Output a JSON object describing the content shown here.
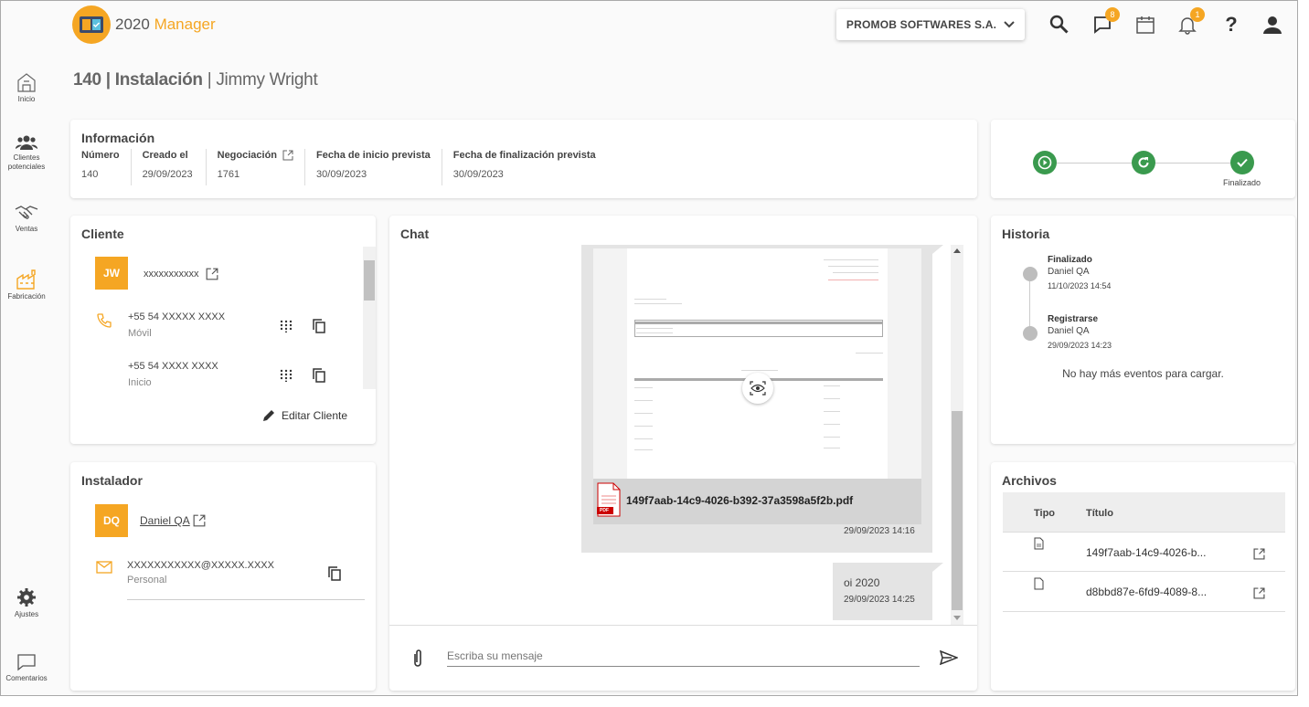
{
  "app": {
    "name_a": "2020",
    "name_b": "Manager",
    "company": "PROMOB SOFTWARES S.A.",
    "messages_count": "8",
    "notifications_count": "1",
    "help_label": "?"
  },
  "nav": [
    {
      "label": "Inicio"
    },
    {
      "label": "Clientes potenciales"
    },
    {
      "label": "Ventas"
    },
    {
      "label": "Fabricación"
    },
    {
      "label": "Ajustes"
    },
    {
      "label": "Comentarios"
    }
  ],
  "title": {
    "bold": "140 | Instalación",
    "normal": " | Jimmy Wright"
  },
  "info": {
    "title": "Información",
    "columns": [
      {
        "label": "Número",
        "value": "140"
      },
      {
        "label": "Creado el",
        "value": "29/09/2023"
      },
      {
        "label": "Negociación",
        "value": "1761"
      },
      {
        "label": "Fecha de inicio prevista",
        "value": "30/09/2023"
      },
      {
        "label": "Fecha de finalización prevista",
        "value": "30/09/2023"
      }
    ]
  },
  "progress": {
    "final_label": "Finalizado"
  },
  "client": {
    "title": "Cliente",
    "initials": "JW",
    "name": "xxxxxxxxxxx",
    "phones": [
      {
        "number": "+55 54  XXXXX XXXX",
        "type": "Móvil"
      },
      {
        "number": "+55 54  XXXX XXXX",
        "type": "Inicio"
      }
    ],
    "edit_label": "Editar Cliente"
  },
  "installer": {
    "title": "Instalador",
    "initials": "DQ",
    "name": "Daniel QA",
    "email": "XXXXXXXXXXX@XXXXX.XXXX",
    "email_type": "Personal"
  },
  "chat": {
    "title": "Chat",
    "file_name": "149f7aab-14c9-4026-b392-37a3598a5f2b.pdf",
    "file_time": "29/09/2023 14:16",
    "pdf_badge": "PDF",
    "message": "oi 2020",
    "message_time": "29/09/2023 14:25",
    "placeholder": "Escriba su mensaje"
  },
  "history": {
    "title": "Historia",
    "events": [
      {
        "event": "Finalizado",
        "user": "Daniel QA",
        "date": "11/10/2023 14:54"
      },
      {
        "event": "Registrarse",
        "user": "Daniel QA",
        "date": "29/09/2023 14:23"
      }
    ],
    "empty": "No hay más eventos para cargar."
  },
  "files": {
    "title": "Archivos",
    "col_type": "Tipo",
    "col_title": "Título",
    "rows": [
      {
        "name": "149f7aab-14c9-4026-b..."
      },
      {
        "name": "d8bbd87e-6fd9-4089-8..."
      }
    ]
  },
  "colors": {
    "accent": "#f5a623",
    "success": "#3a9a4e"
  }
}
